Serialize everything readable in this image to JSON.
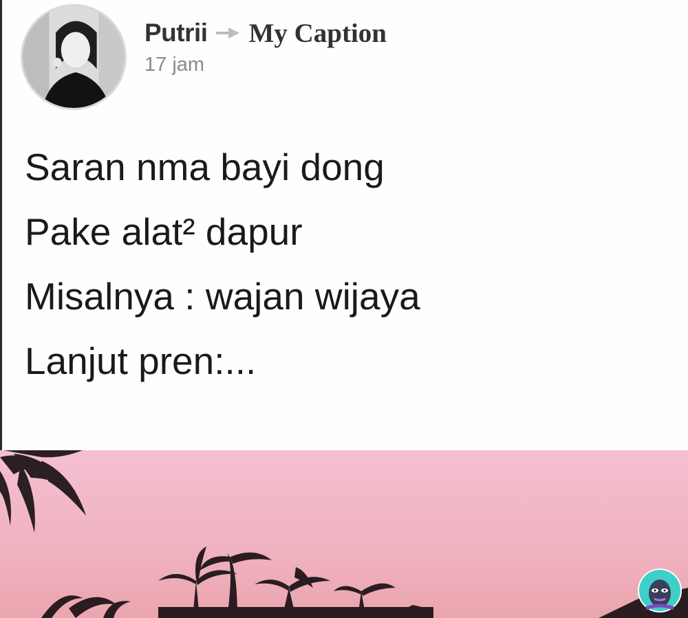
{
  "post": {
    "author": "Putrii",
    "group": "My Caption",
    "time": "17 jam",
    "lines": [
      "Saran nma bayi dong",
      "Pake alat² dapur",
      "Misalnya : wajan wijaya",
      "Lanjut pren:..."
    ]
  },
  "icons": {
    "arrow": "right-triangle-arrow-icon",
    "avatar": "profile-photo",
    "sticker": "cartoon-sticker-icon"
  },
  "colors": {
    "text": "#1a1a1a",
    "meta_gray": "#8a8a8a",
    "sky_pink": "#f2b5c4"
  }
}
